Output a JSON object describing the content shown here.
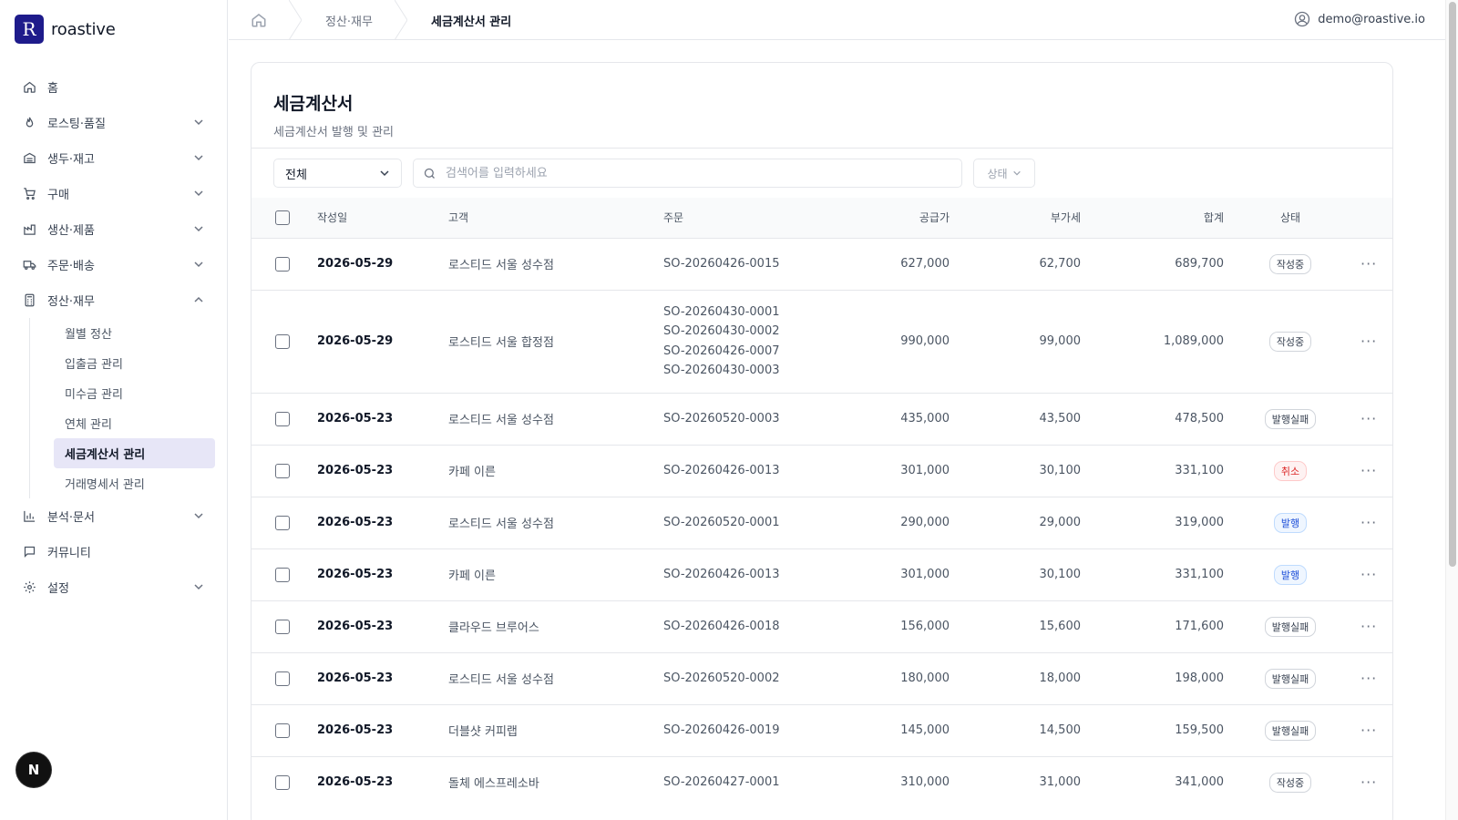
{
  "brand": {
    "name": "roastive",
    "mark": "R"
  },
  "sidebar": {
    "items": [
      {
        "label": "홈",
        "icon": "home-icon"
      },
      {
        "label": "로스팅·품질",
        "icon": "flame-icon"
      },
      {
        "label": "생두·재고",
        "icon": "warehouse-icon"
      },
      {
        "label": "구매",
        "icon": "cart-icon"
      },
      {
        "label": "생산·제품",
        "icon": "factory-icon"
      },
      {
        "label": "주문·배송",
        "icon": "truck-icon"
      },
      {
        "label": "정산·재무",
        "icon": "calculator-icon"
      }
    ],
    "finance_sub": [
      "월별 정산",
      "입출금 관리",
      "미수금 관리",
      "연체 관리",
      "세금계산서 관리",
      "거래명세서 관리"
    ],
    "bottom_items": [
      {
        "label": "분석·문서",
        "icon": "bar-chart-icon"
      },
      {
        "label": "커뮤니티",
        "icon": "message-icon"
      },
      {
        "label": "설정",
        "icon": "gear-icon"
      }
    ]
  },
  "badge_n": "N",
  "topbar": {
    "crumb_section": "정산·재무",
    "crumb_current": "세금계산서 관리",
    "user_email": "demo@roastive.io"
  },
  "page": {
    "title": "세금계산서",
    "subtitle": "세금계산서 발행 및 관리"
  },
  "filters": {
    "type_selected": "전체",
    "search_placeholder": "검색어를 입력하세요",
    "status_label": "상태"
  },
  "table": {
    "headers": {
      "date": "작성일",
      "customer": "고객",
      "order": "주문",
      "supply": "공급가",
      "vat": "부가세",
      "total": "합계",
      "status": "상태"
    },
    "rows": [
      {
        "date": "2026-05-29",
        "customer": "로스티드 서울 성수점",
        "orders": [
          "SO-20260426-0015"
        ],
        "supply": "627,000",
        "vat": "62,700",
        "total": "689,700",
        "status": "작성중",
        "status_color": "gray"
      },
      {
        "date": "2026-05-29",
        "customer": "로스티드 서울 합정점",
        "orders": [
          "SO-20260430-0001",
          "SO-20260430-0002",
          "SO-20260426-0007",
          "SO-20260430-0003"
        ],
        "supply": "990,000",
        "vat": "99,000",
        "total": "1,089,000",
        "status": "작성중",
        "status_color": "gray"
      },
      {
        "date": "2026-05-23",
        "customer": "로스티드 서울 성수점",
        "orders": [
          "SO-20260520-0003"
        ],
        "supply": "435,000",
        "vat": "43,500",
        "total": "478,500",
        "status": "발행실패",
        "status_color": "gray"
      },
      {
        "date": "2026-05-23",
        "customer": "카페 이른",
        "orders": [
          "SO-20260426-0013"
        ],
        "supply": "301,000",
        "vat": "30,100",
        "total": "331,100",
        "status": "취소",
        "status_color": "red"
      },
      {
        "date": "2026-05-23",
        "customer": "로스티드 서울 성수점",
        "orders": [
          "SO-20260520-0001"
        ],
        "supply": "290,000",
        "vat": "29,000",
        "total": "319,000",
        "status": "발행",
        "status_color": "blue"
      },
      {
        "date": "2026-05-23",
        "customer": "카페 이른",
        "orders": [
          "SO-20260426-0013"
        ],
        "supply": "301,000",
        "vat": "30,100",
        "total": "331,100",
        "status": "발행",
        "status_color": "blue"
      },
      {
        "date": "2026-05-23",
        "customer": "클라우드 브루어스",
        "orders": [
          "SO-20260426-0018"
        ],
        "supply": "156,000",
        "vat": "15,600",
        "total": "171,600",
        "status": "발행실패",
        "status_color": "gray"
      },
      {
        "date": "2026-05-23",
        "customer": "로스티드 서울 성수점",
        "orders": [
          "SO-20260520-0002"
        ],
        "supply": "180,000",
        "vat": "18,000",
        "total": "198,000",
        "status": "발행실패",
        "status_color": "gray"
      },
      {
        "date": "2026-05-23",
        "customer": "더블샷 커피랩",
        "orders": [
          "SO-20260426-0019"
        ],
        "supply": "145,000",
        "vat": "14,500",
        "total": "159,500",
        "status": "발행실패",
        "status_color": "gray"
      },
      {
        "date": "2026-05-23",
        "customer": "돌체 에스프레소바",
        "orders": [
          "SO-20260427-0001"
        ],
        "supply": "310,000",
        "vat": "31,000",
        "total": "341,000",
        "status": "작성중",
        "status_color": "gray"
      }
    ]
  },
  "colors": {
    "brand": "#1e1b8b",
    "active_bg": "#e7e6f7",
    "cancel": "#dc2626",
    "issued": "#1d4ed8"
  }
}
